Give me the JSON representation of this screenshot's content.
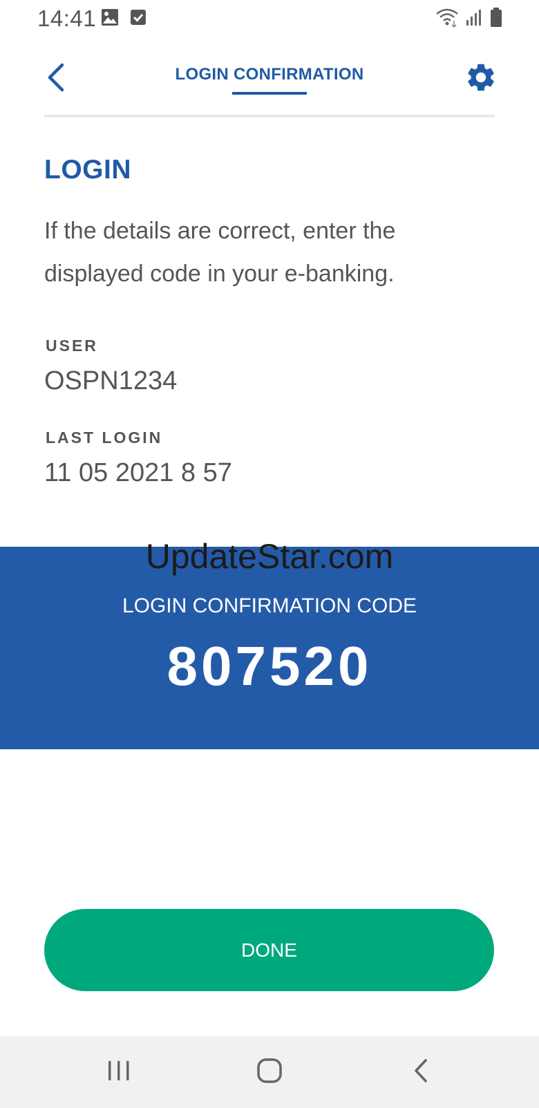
{
  "status_bar": {
    "time": "14:41",
    "icons": [
      "gallery-icon",
      "check-icon",
      "wifi-icon",
      "signal-icon",
      "battery-icon"
    ]
  },
  "header": {
    "title": "LOGIN CONFIRMATION",
    "back_icon": "chevron-left-icon",
    "settings_icon": "gear-icon"
  },
  "content": {
    "heading": "LOGIN",
    "instruction": "If the details are correct, enter the displayed code in your e-banking.",
    "user_label": "USER",
    "user_value": "OSPN1234",
    "last_login_label": "LAST LOGIN",
    "last_login_value": "11 05 2021 8 57"
  },
  "code_banner": {
    "label": "LOGIN CONFIRMATION CODE",
    "code": "807520",
    "watermark": "UpdateStar.com"
  },
  "actions": {
    "done_label": "DONE"
  },
  "nav_bar": {
    "icons": [
      "recent-apps-icon",
      "home-icon",
      "back-icon"
    ]
  },
  "colors": {
    "brand_blue": "#1f5ba6",
    "banner_blue": "#245ba8",
    "done_green": "#00a97c",
    "text_gray": "#555555",
    "nav_bg": "#f1f1f1"
  }
}
